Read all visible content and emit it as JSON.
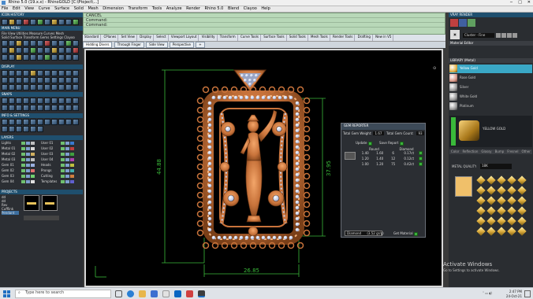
{
  "window": {
    "title": "Rhino 5.0 (19.x.x) - RhinoGOLD [C:\\Ptoject\\...]"
  },
  "menubar": [
    "File",
    "Edit",
    "View",
    "Curve",
    "Surface",
    "Solid",
    "Mesh",
    "Dimension",
    "Transform",
    "Tools",
    "Analyze",
    "Render",
    "Rhino 5.0",
    "Blend",
    "Clayoo",
    "Help"
  ],
  "left": {
    "icon_history": "ICON HISTORY",
    "main_menu": "MAIN MENU",
    "main_menu_items": [
      "File",
      "View",
      "Utilities",
      "Measure",
      "Curves",
      "Mesh",
      "Solid",
      "Surface",
      "Transform",
      "Gems",
      "Settings",
      "Clayoo"
    ],
    "display": "DISPLAY",
    "snaps": "SNAPS",
    "info_settings": "INFO & SETTINGS",
    "layers": "LAYERS",
    "layer_names": [
      [
        "Lights",
        "User 01"
      ],
      [
        "Metal 01",
        "User 02"
      ],
      [
        "Metal 02",
        "User 03"
      ],
      [
        "Metal 03",
        "User 04"
      ],
      [
        "Gem 01",
        "Heads"
      ],
      [
        "Gem 02",
        "Prongs"
      ],
      [
        "Gem 03",
        "Cutting"
      ],
      [
        "Gem 04",
        "Templates"
      ]
    ],
    "projects": "PROJECTS",
    "project_list": [
      "dd",
      "dd",
      "Rev",
      "Cufflink",
      "Pendant"
    ]
  },
  "command": {
    "line1": "CANCEL",
    "line2": "Command:",
    "line3": "Command:"
  },
  "toolbar_tabs": [
    "Standard",
    "CPlanes",
    "Set View",
    "Display",
    "Select",
    "Viewport Layout",
    "Visibility",
    "Transform",
    "Curve Tools",
    "Surface Tools",
    "Solid Tools",
    "Mesh Tools",
    "Render Tools",
    "Drafting",
    "New in V5"
  ],
  "view_tabs": [
    "Hidding Divers",
    "Through Finger",
    "Side View",
    "Perspective",
    "+"
  ],
  "viewport": {
    "dim_height": "44.88",
    "dim_body": "37.95",
    "dim_width": "26.85"
  },
  "gem_reporter": {
    "title": "GEM REPORTER",
    "total_weight_label": "Total Gem Weight:",
    "total_weight": "1.67",
    "total_count_label": "Total Gem Count:",
    "total_count": "93",
    "update": "Update",
    "save_report": "Save Report",
    "col_round": "Round",
    "col_diamond": "Diamond",
    "rows": [
      [
        "1.40",
        "1.60",
        "6",
        "0.17ct"
      ],
      [
        "1.20",
        "1.40",
        "12",
        "0.12ct"
      ],
      [
        "1.00",
        "1.20",
        "75",
        "0.42ct"
      ]
    ],
    "material_select": "Diamond",
    "material_value": "(3.52 gr/g)",
    "get_material": "Get Material"
  },
  "right": {
    "vray_title": "VRAY RENDER",
    "cluster_label": "Cluster - Fine",
    "material_editor": "Material Editor",
    "library_title": "LIBRARY (Metal)",
    "materials": [
      "Yellow Gold",
      "Rose Gold",
      "Silver",
      "White Gold",
      "Platinum"
    ],
    "selected_material": "YELLOW GOLD",
    "metal_quality_label": "METAL QUALITY",
    "metal_quality_value": "18K",
    "side_tabs": [
      "Color",
      "Reflection",
      "Glossy",
      "Bump",
      "Fresnel",
      "Other"
    ]
  },
  "activation": {
    "line1": "Activate Windows",
    "line2": "Go to Settings to activate Windows."
  },
  "taskbar": {
    "search_placeholder": "Type here to search",
    "time": "2:47 PM",
    "date": "24-Oct-21"
  },
  "colors": {
    "gold": "#c8733b",
    "dimension_green": "#3ab93a",
    "command_bg": "#b8d8b8",
    "panel_header": "#1f4f6e"
  }
}
